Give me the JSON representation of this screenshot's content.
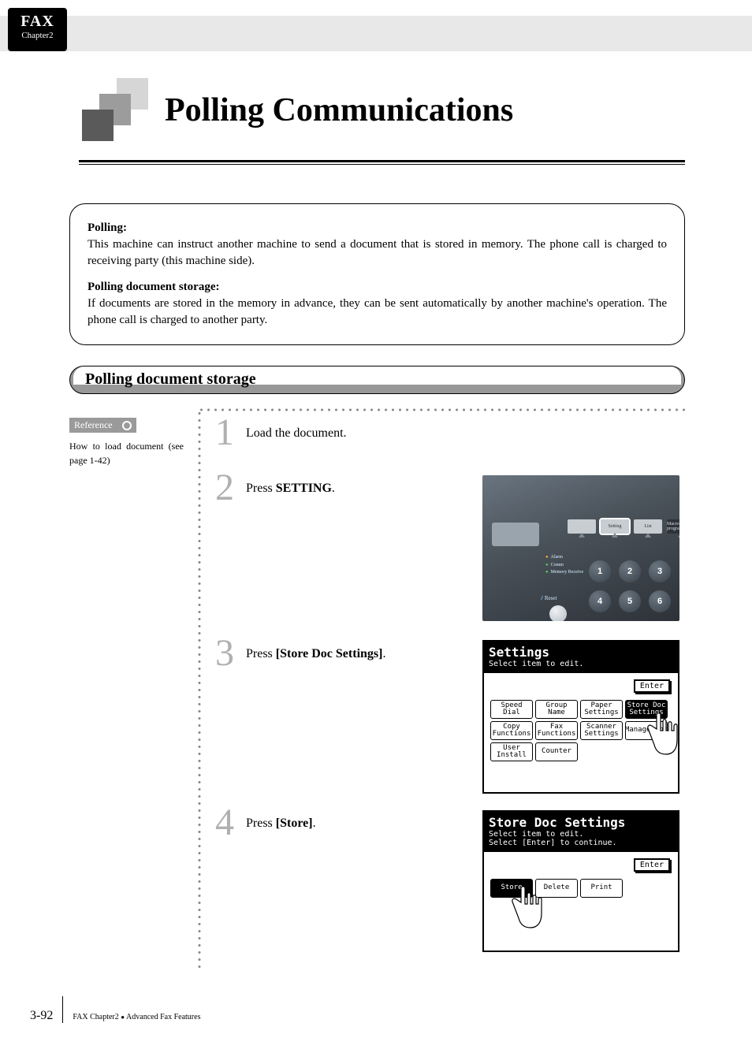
{
  "tab": {
    "fax": "FAX",
    "chapter": "Chapter2"
  },
  "title": "Polling Communications",
  "info": {
    "polling_label": "Polling:",
    "polling_text": "This machine can instruct another machine to send a document that is stored in memory. The phone call is charged to receiving party (this machine side).",
    "storage_label": "Polling document storage:",
    "storage_text": "If documents are stored in the memory in advance, they can be sent automatically by another machine's operation. The phone call is charged to another party."
  },
  "section_title": "Polling document storage",
  "reference": {
    "badge": "Reference",
    "text": "How to load document (see page 1-42)"
  },
  "steps": {
    "s1": {
      "num": "1",
      "text_a": "Load the document."
    },
    "s2": {
      "num": "2",
      "text_a": "Press ",
      "bold": "SETTING",
      "text_b": "."
    },
    "s3": {
      "num": "3",
      "text_a": "Press ",
      "bold": "[Store Doc Settings]",
      "text_b": "."
    },
    "s4": {
      "num": "4",
      "text_a": "Press ",
      "bold": "[Store]",
      "text_b": "."
    }
  },
  "panel": {
    "topbtns": [
      "",
      "Setting",
      "List",
      "Macro program"
    ],
    "leds": [
      "Alarm",
      "Comm",
      "Memory Receive"
    ],
    "reset": "Reset",
    "keys": [
      "1",
      "2",
      "3",
      "4",
      "5",
      "6"
    ]
  },
  "lcd3": {
    "title": "Settings",
    "sub": "Select item to edit.",
    "enter": "Enter",
    "row1": [
      "Speed Dial",
      "Group Name",
      "Paper\nSettings",
      "Store Doc\nSettings"
    ],
    "row2": [
      "Copy\nFunctions",
      "Fax\nFunctions",
      "Scanner\nSettings",
      "Management"
    ],
    "row3": [
      "User\nInstall",
      "Counter"
    ]
  },
  "lcd4": {
    "title": "Store Doc Settings",
    "sub1": "Select item to edit.",
    "sub2": "Select [Enter] to continue.",
    "enter": "Enter",
    "buttons": [
      "Store",
      "Delete",
      "Print"
    ]
  },
  "footer": {
    "page": "3-92",
    "chapter": "FAX Chapter2",
    "topic": "Advanced Fax Features"
  }
}
